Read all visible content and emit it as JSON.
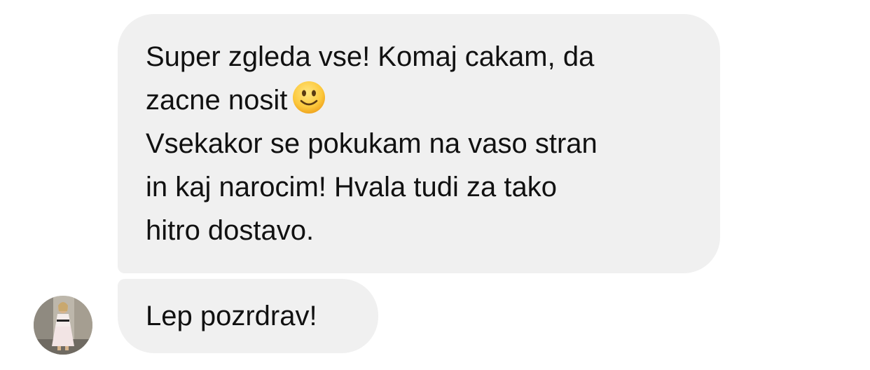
{
  "conversation": {
    "messages": [
      {
        "lines": [
          "Super zgleda vse! Komaj cakam, da",
          "zacne nosit",
          "Vsekakor se pokukam na vaso stran",
          "in kaj narocim! Hvala tudi za tako",
          "hitro dostavo."
        ],
        "emoji": "slightly-smiling-face-icon"
      },
      {
        "lines": [
          "Lep pozrdrav!"
        ]
      }
    ],
    "sender_avatar": "avatar-photo",
    "bubble_color": "#f0f0f0",
    "text_color": "#111111"
  }
}
